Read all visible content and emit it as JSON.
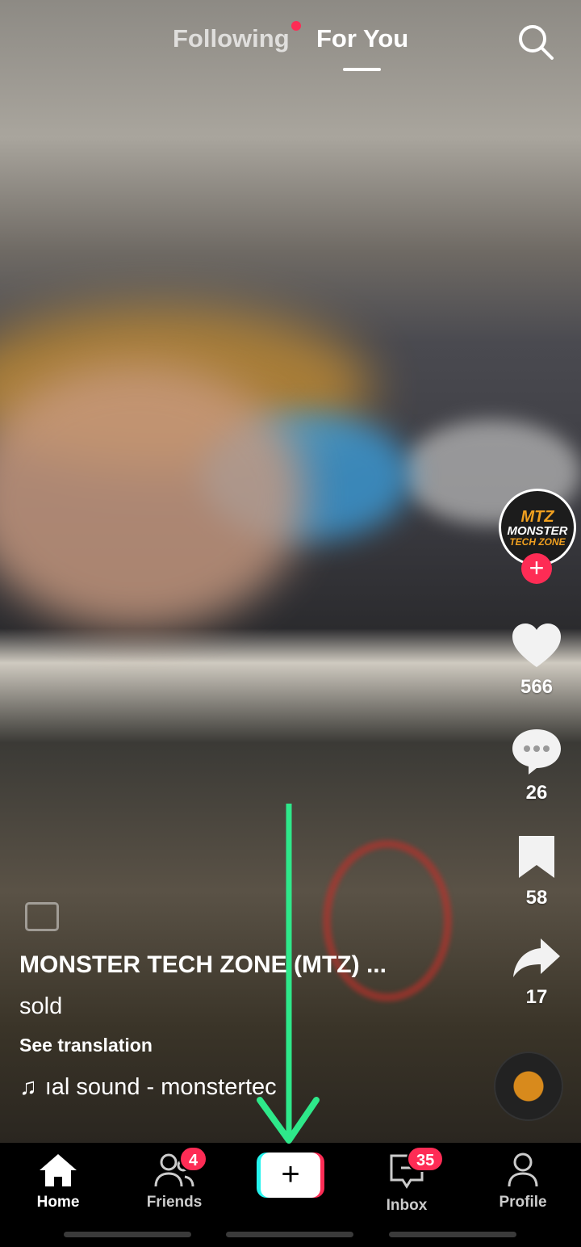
{
  "topnav": {
    "following": "Following",
    "for_you": "For You",
    "following_has_new": true
  },
  "creator": {
    "avatar_line1": "MTZ",
    "avatar_line2": "MONSTER",
    "avatar_line3": "TECH ZONE",
    "follow": "+"
  },
  "actions": {
    "likes": "566",
    "comments": "26",
    "saves": "58",
    "shares": "17"
  },
  "caption": {
    "author": "MONSTER TECH ZONE (MTZ) ...",
    "description": "sold",
    "see_translation": "See translation",
    "sound": "ıal sound - monstertec"
  },
  "bottomnav": {
    "home": "Home",
    "friends": "Friends",
    "friends_badge": "4",
    "create": "+",
    "inbox": "Inbox",
    "inbox_badge": "35",
    "profile": "Profile"
  },
  "colors": {
    "accent": "#fe2c55",
    "annotation_arrow": "#2ee88a"
  }
}
